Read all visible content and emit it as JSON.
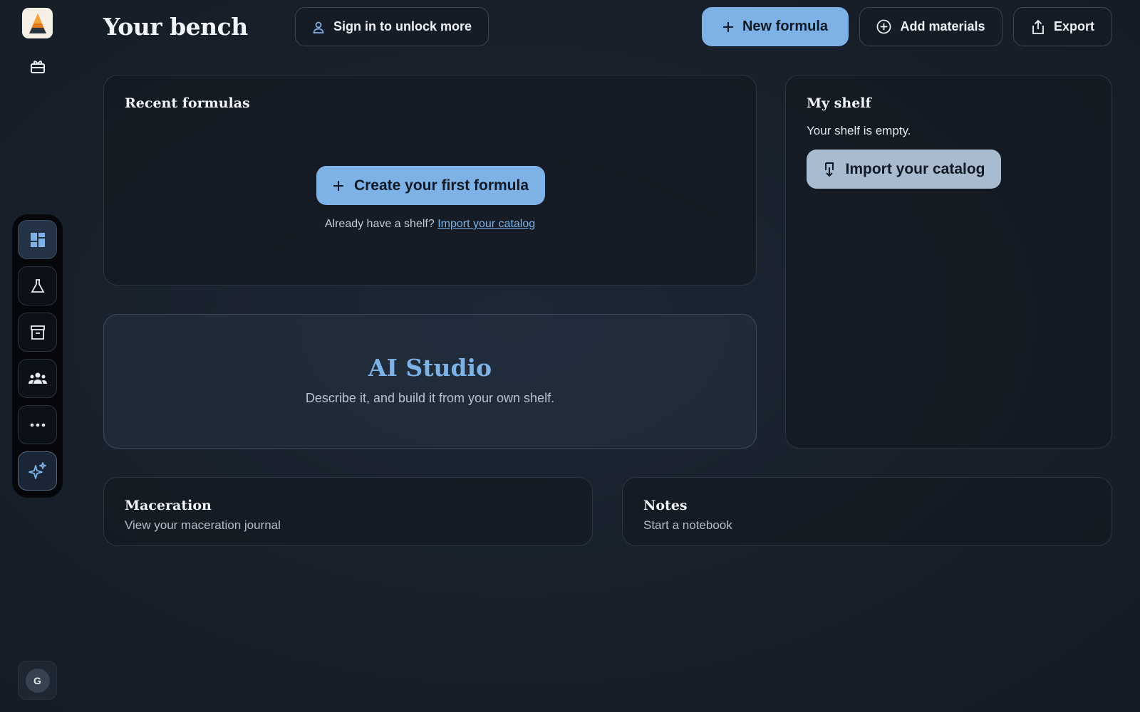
{
  "brand": {
    "logo_icon": "pyramid-logo-icon",
    "gift_icon": "gift-icon"
  },
  "rail": {
    "items": [
      {
        "icon": "dashboard-icon",
        "active": true
      },
      {
        "icon": "flask-icon",
        "active": false
      },
      {
        "icon": "archive-box-icon",
        "active": false
      },
      {
        "icon": "community-icon",
        "active": false
      },
      {
        "icon": "more-icon",
        "active": false
      },
      {
        "icon": "sparkles-icon",
        "active": false
      }
    ],
    "avatar_initial": "G"
  },
  "header": {
    "title": "Your bench",
    "signin_label": "Sign in to unlock more",
    "new_formula_label": "New formula",
    "add_materials_label": "Add materials",
    "export_label": "Export"
  },
  "recent": {
    "title": "Recent formulas",
    "create_label": "Create your first formula",
    "already_text": "Already have a shelf?",
    "import_link": "Import your catalog"
  },
  "ai_studio": {
    "title": "AI Studio",
    "subtitle": "Describe it, and build it from your own shelf."
  },
  "shelf": {
    "title": "My shelf",
    "empty_text": "Your shelf is empty.",
    "import_label": "Import your catalog"
  },
  "maceration": {
    "title": "Maceration",
    "subtitle": "View your maceration journal"
  },
  "notes": {
    "title": "Notes",
    "subtitle": "Start a notebook"
  },
  "colors": {
    "accent": "#7eb2e6",
    "background": "#18212c",
    "import_button": "#a9bccf"
  }
}
